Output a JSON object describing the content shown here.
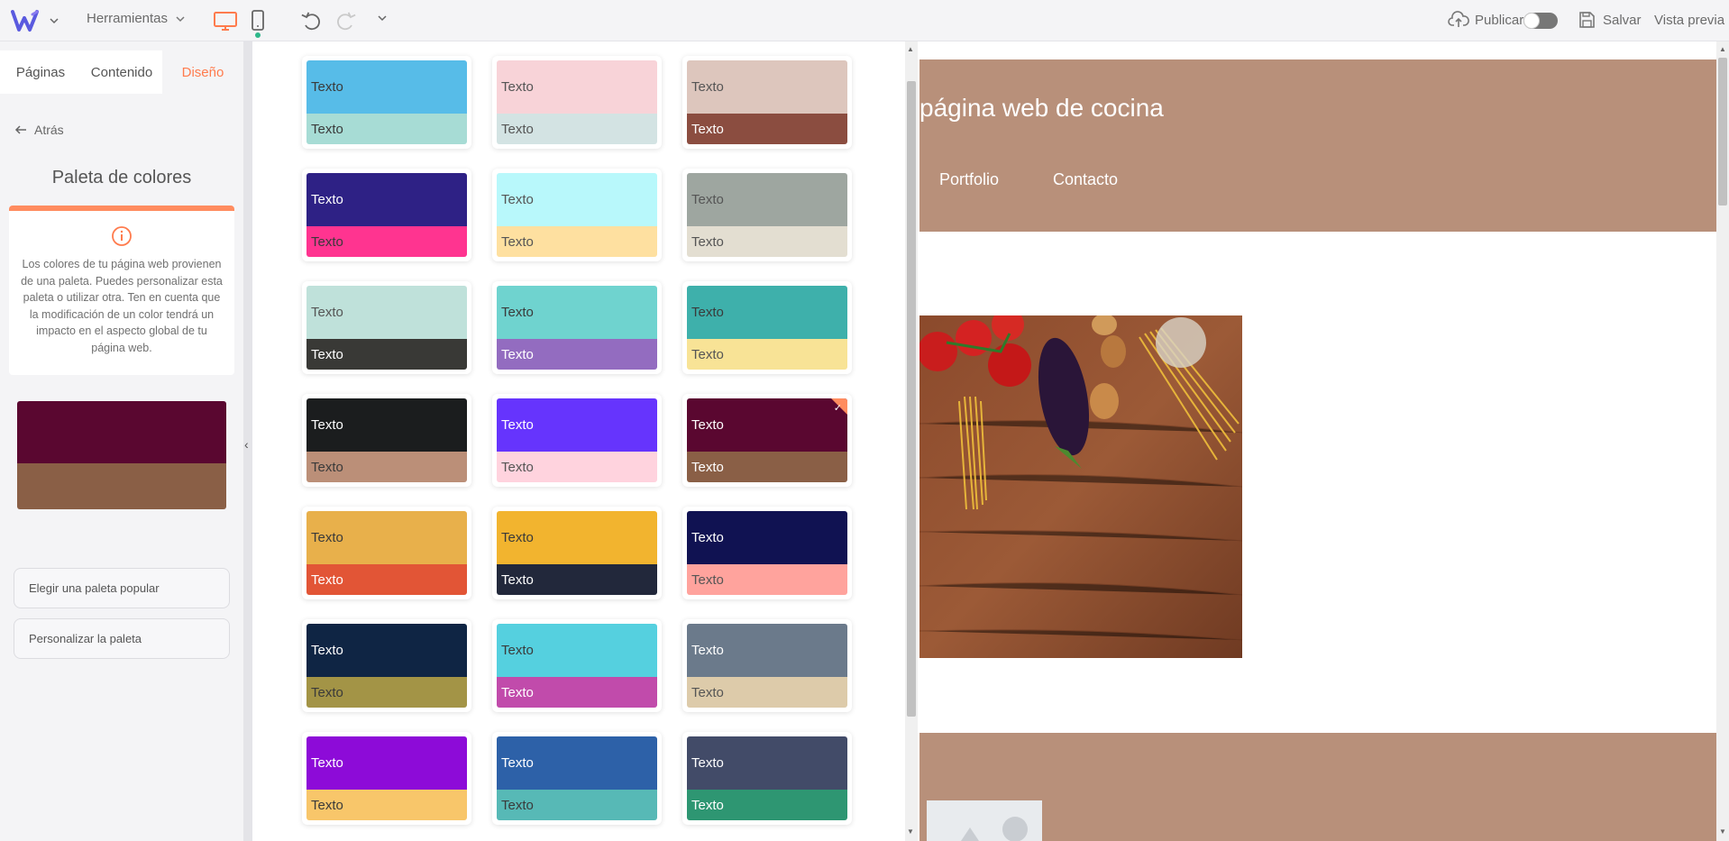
{
  "toolbar": {
    "tools_label": "Herramientas",
    "publish_label": "Publicar",
    "save_label": "Salvar",
    "preview_label": "Vista previa",
    "accent_color": "#ff7b4d"
  },
  "sidebar": {
    "tabs": [
      {
        "label": "Páginas"
      },
      {
        "label": "Contenido"
      },
      {
        "label": "Diseño",
        "active": true
      }
    ],
    "back_label": "Atrás",
    "title": "Paleta de colores",
    "info_text": "Los colores de tu página web provienen de una paleta. Puedes personalizar esta paleta o utilizar otra. Ten en cuenta que la modificación de un color tendrá un impacto en el aspecto global de tu página web.",
    "current_palette": {
      "primary": "#5a0730",
      "secondary": "#8a5f46"
    },
    "choose_popular_label": "Elegir una paleta popular",
    "customize_label": "Personalizar la paleta"
  },
  "palettes": [
    {
      "top": "#57bce8",
      "bottom": "#a7dcd5",
      "top_text": "#3a3a3a",
      "bottom_text": "#3a3a3a",
      "top_label": "Texto",
      "bottom_label": "Texto"
    },
    {
      "top": "#f8d3d8",
      "bottom": "#d3e3e3",
      "top_text": "#555555",
      "bottom_text": "#555555",
      "top_label": "Texto",
      "bottom_label": "Texto"
    },
    {
      "top": "#ddc6bd",
      "bottom": "#8b4d40",
      "top_text": "#555555",
      "bottom_text": "#ffffff",
      "top_label": "Texto",
      "bottom_label": "Texto"
    },
    {
      "top": "#2e2185",
      "bottom": "#ff3490",
      "top_text": "#ffffff",
      "bottom_text": "#3a3a3a",
      "top_label": "Texto",
      "bottom_label": "Texto"
    },
    {
      "top": "#b8f8fb",
      "bottom": "#fee0a0",
      "top_text": "#555555",
      "bottom_text": "#555555",
      "top_label": "Texto",
      "bottom_label": "Texto"
    },
    {
      "top": "#9ea6a0",
      "bottom": "#e3ded1",
      "top_text": "#555555",
      "bottom_text": "#555555",
      "top_label": "Texto",
      "bottom_label": "Texto"
    },
    {
      "top": "#bfe1da",
      "bottom": "#393936",
      "top_text": "#555555",
      "bottom_text": "#ffffff",
      "top_label": "Texto",
      "bottom_label": "Texto"
    },
    {
      "top": "#6fd3cf",
      "bottom": "#936cc0",
      "top_text": "#3a3a3a",
      "bottom_text": "#ffffff",
      "top_label": "Texto",
      "bottom_label": "Texto"
    },
    {
      "top": "#3eb0ab",
      "bottom": "#f8e396",
      "top_text": "#3a3a3a",
      "bottom_text": "#555555",
      "top_label": "Texto",
      "bottom_label": "Texto"
    },
    {
      "top": "#1b1d1e",
      "bottom": "#bb8f78",
      "top_text": "#ffffff",
      "bottom_text": "#3a3a3a",
      "top_label": "Texto",
      "bottom_label": "Texto"
    },
    {
      "top": "#6634fd",
      "bottom": "#ffd3de",
      "top_text": "#ffffff",
      "bottom_text": "#555555",
      "top_label": "Texto",
      "bottom_label": "Texto"
    },
    {
      "top": "#5a0730",
      "bottom": "#8a5f46",
      "top_text": "#ffffff",
      "bottom_text": "#ffffff",
      "top_label": "Texto",
      "bottom_label": "Texto",
      "selected": true
    },
    {
      "top": "#e8b04b",
      "bottom": "#e25536",
      "top_text": "#3a3a3a",
      "bottom_text": "#ffffff",
      "top_label": "Texto",
      "bottom_label": "Texto"
    },
    {
      "top": "#f2b42f",
      "bottom": "#22283b",
      "top_text": "#3a3a3a",
      "bottom_text": "#ffffff",
      "top_label": "Texto",
      "bottom_label": "Texto"
    },
    {
      "top": "#101252",
      "bottom": "#ffa39d",
      "top_text": "#ffffff",
      "bottom_text": "#555555",
      "top_label": "Texto",
      "bottom_label": "Texto"
    },
    {
      "top": "#0f2544",
      "bottom": "#a39446",
      "top_text": "#ffffff",
      "bottom_text": "#3a3a3a",
      "top_label": "Texto",
      "bottom_label": "Texto"
    },
    {
      "top": "#55d0df",
      "bottom": "#c14bab",
      "top_text": "#3a3a3a",
      "bottom_text": "#ffffff",
      "top_label": "Texto",
      "bottom_label": "Texto"
    },
    {
      "top": "#6b7a8b",
      "bottom": "#ddcbaa",
      "top_text": "#ffffff",
      "bottom_text": "#555555",
      "top_label": "Texto",
      "bottom_label": "Texto"
    },
    {
      "top": "#8d0bd8",
      "bottom": "#f8c66a",
      "top_text": "#ffffff",
      "bottom_text": "#3a3a3a",
      "top_label": "Texto",
      "bottom_label": "Texto"
    },
    {
      "top": "#2d61a8",
      "bottom": "#57b9b6",
      "top_text": "#ffffff",
      "bottom_text": "#3a3a3a",
      "top_label": "Texto",
      "bottom_label": "Texto"
    },
    {
      "top": "#424b68",
      "bottom": "#2e9672",
      "top_text": "#ffffff",
      "bottom_text": "#ffffff",
      "top_label": "Texto",
      "bottom_label": "Texto"
    }
  ],
  "preview": {
    "site_title": "página web de cocina",
    "nav": [
      {
        "label": "Portfolio"
      },
      {
        "label": "Contacto"
      }
    ],
    "header_color": "#b8907a"
  }
}
